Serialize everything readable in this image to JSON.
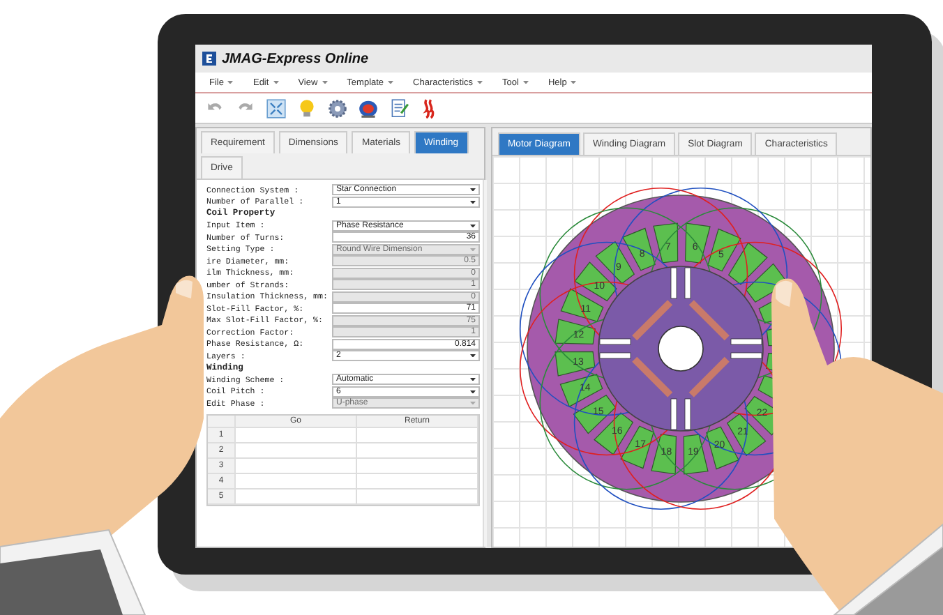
{
  "window": {
    "title": "JMAG-Express Online"
  },
  "menu": [
    {
      "label": "File"
    },
    {
      "label": "Edit"
    },
    {
      "label": "View"
    },
    {
      "label": "Template"
    },
    {
      "label": "Characteristics"
    },
    {
      "label": "Tool"
    },
    {
      "label": "Help"
    }
  ],
  "left_panel": {
    "tab_rows": [
      [
        {
          "label": "Requirement",
          "selected": false
        },
        {
          "label": "Dimensions",
          "selected": false
        },
        {
          "label": "Materials",
          "selected": false
        },
        {
          "label": "Winding",
          "selected": true
        }
      ],
      [
        {
          "label": "Drive",
          "selected": false
        }
      ]
    ],
    "form": [
      {
        "kind": "select",
        "label": "Connection System :",
        "value": "Star Connection",
        "disabled": false
      },
      {
        "kind": "select",
        "label": "Number of Parallel :",
        "value": "1",
        "disabled": false
      },
      {
        "kind": "heading",
        "label": "Coil Property"
      },
      {
        "kind": "select",
        "label": "Input Item :",
        "value": "Phase Resistance",
        "disabled": false
      },
      {
        "kind": "input",
        "label": "Number of Turns:",
        "value": "36",
        "disabled": false
      },
      {
        "kind": "select",
        "label": "Setting Type :",
        "value": "Round Wire Dimension",
        "disabled": true
      },
      {
        "kind": "input",
        "label": "ire Diameter, mm:",
        "value": "0.5",
        "disabled": true
      },
      {
        "kind": "input",
        "label": "ilm Thickness, mm:",
        "value": "0",
        "disabled": true
      },
      {
        "kind": "input",
        "label": "umber of Strands:",
        "value": "1",
        "disabled": true
      },
      {
        "kind": "input",
        "label": "Insulation Thickness, mm:",
        "value": "0",
        "disabled": true
      },
      {
        "kind": "input",
        "label": "Slot-Fill Factor, %:",
        "value": "71",
        "disabled": false
      },
      {
        "kind": "input",
        "label": "Max Slot-Fill Factor, %:",
        "value": "75",
        "disabled": true
      },
      {
        "kind": "input",
        "label": "Correction Factor:",
        "value": "1",
        "disabled": true
      },
      {
        "kind": "input",
        "label": "Phase Resistance, Ω:",
        "value": "0.814",
        "disabled": false
      },
      {
        "kind": "select",
        "label": "Layers :",
        "value": "2",
        "disabled": false
      },
      {
        "kind": "heading",
        "label": "Winding"
      },
      {
        "kind": "select",
        "label": "Winding Scheme :",
        "value": "Automatic",
        "disabled": false
      },
      {
        "kind": "select",
        "label": "Coil Pitch :",
        "value": "6",
        "disabled": false
      },
      {
        "kind": "select",
        "label": "Edit Phase :",
        "value": "U-phase",
        "disabled": true
      }
    ],
    "table": {
      "columns": [
        "Go",
        "Return"
      ],
      "rows": [
        "1",
        "2",
        "3",
        "4",
        "5"
      ]
    }
  },
  "right_panel": {
    "tabs": [
      {
        "label": "Motor Diagram",
        "selected": true
      },
      {
        "label": "Winding Diagram",
        "selected": false
      },
      {
        "label": "Slot Diagram",
        "selected": false
      },
      {
        "label": "Characteristics",
        "selected": false
      }
    ],
    "slot_labels": [
      "5",
      "6",
      "7",
      "8",
      "9",
      "10",
      "11",
      "12",
      "13",
      "14",
      "15",
      "16",
      "17",
      "18",
      "19",
      "20",
      "21",
      "22"
    ]
  }
}
